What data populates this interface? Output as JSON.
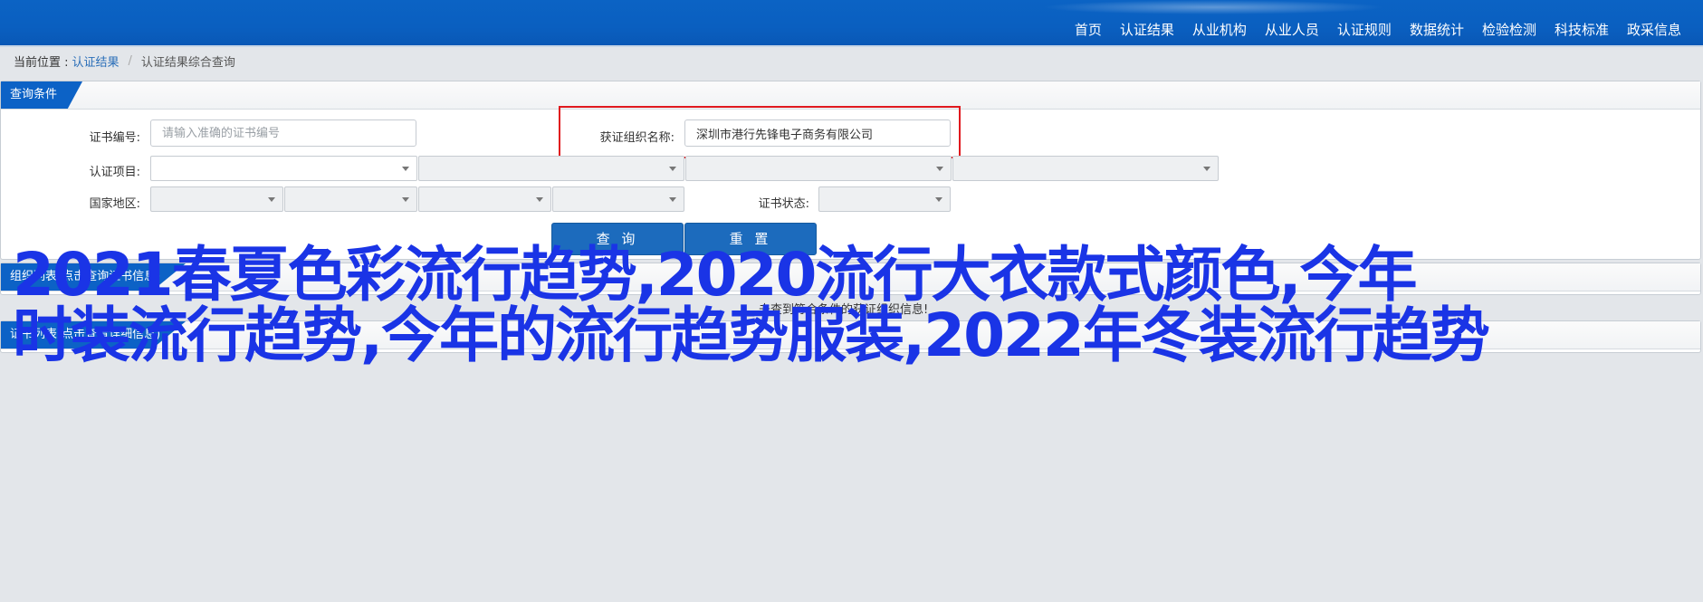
{
  "nav": {
    "items": [
      "首页",
      "认证结果",
      "从业机构",
      "从业人员",
      "认证规则",
      "数据统计",
      "检验检测",
      "科技标准",
      "政采信息"
    ]
  },
  "breadcrumb": {
    "prefix": "当前位置 :",
    "link": "认证结果",
    "separator": "/",
    "current": "认证结果综合查询"
  },
  "query": {
    "tab_title": "查询条件",
    "cert_no_label": "证书编号:",
    "cert_no_placeholder": "请输入准确的证书编号",
    "org_name_label": "获证组织名称:",
    "org_name_value": "深圳市港行先锋电子商务有限公司",
    "project_label": "认证项目:",
    "country_label": "国家地区:",
    "status_label": "证书状态:",
    "search_button": "查 询",
    "reset_button": "重 置"
  },
  "org_panel": {
    "tab_title": "组织列表(点击查询证书信息)",
    "empty_message": "未查到符合条件的获证组织信息!"
  },
  "cert_panel": {
    "tab_title": "证书列表(点击查看详细信息)"
  },
  "watermark": {
    "line1": "2021春夏色彩流行趋势,2020流行大衣款式颜色,今年",
    "line2": "时装流行趋势,今年的流行趋势服装,2022年冬装流行趋势"
  },
  "colors": {
    "brand_blue": "#0c62c6",
    "highlight_red": "#e0191e",
    "watermark_blue": "#1a34e6"
  }
}
